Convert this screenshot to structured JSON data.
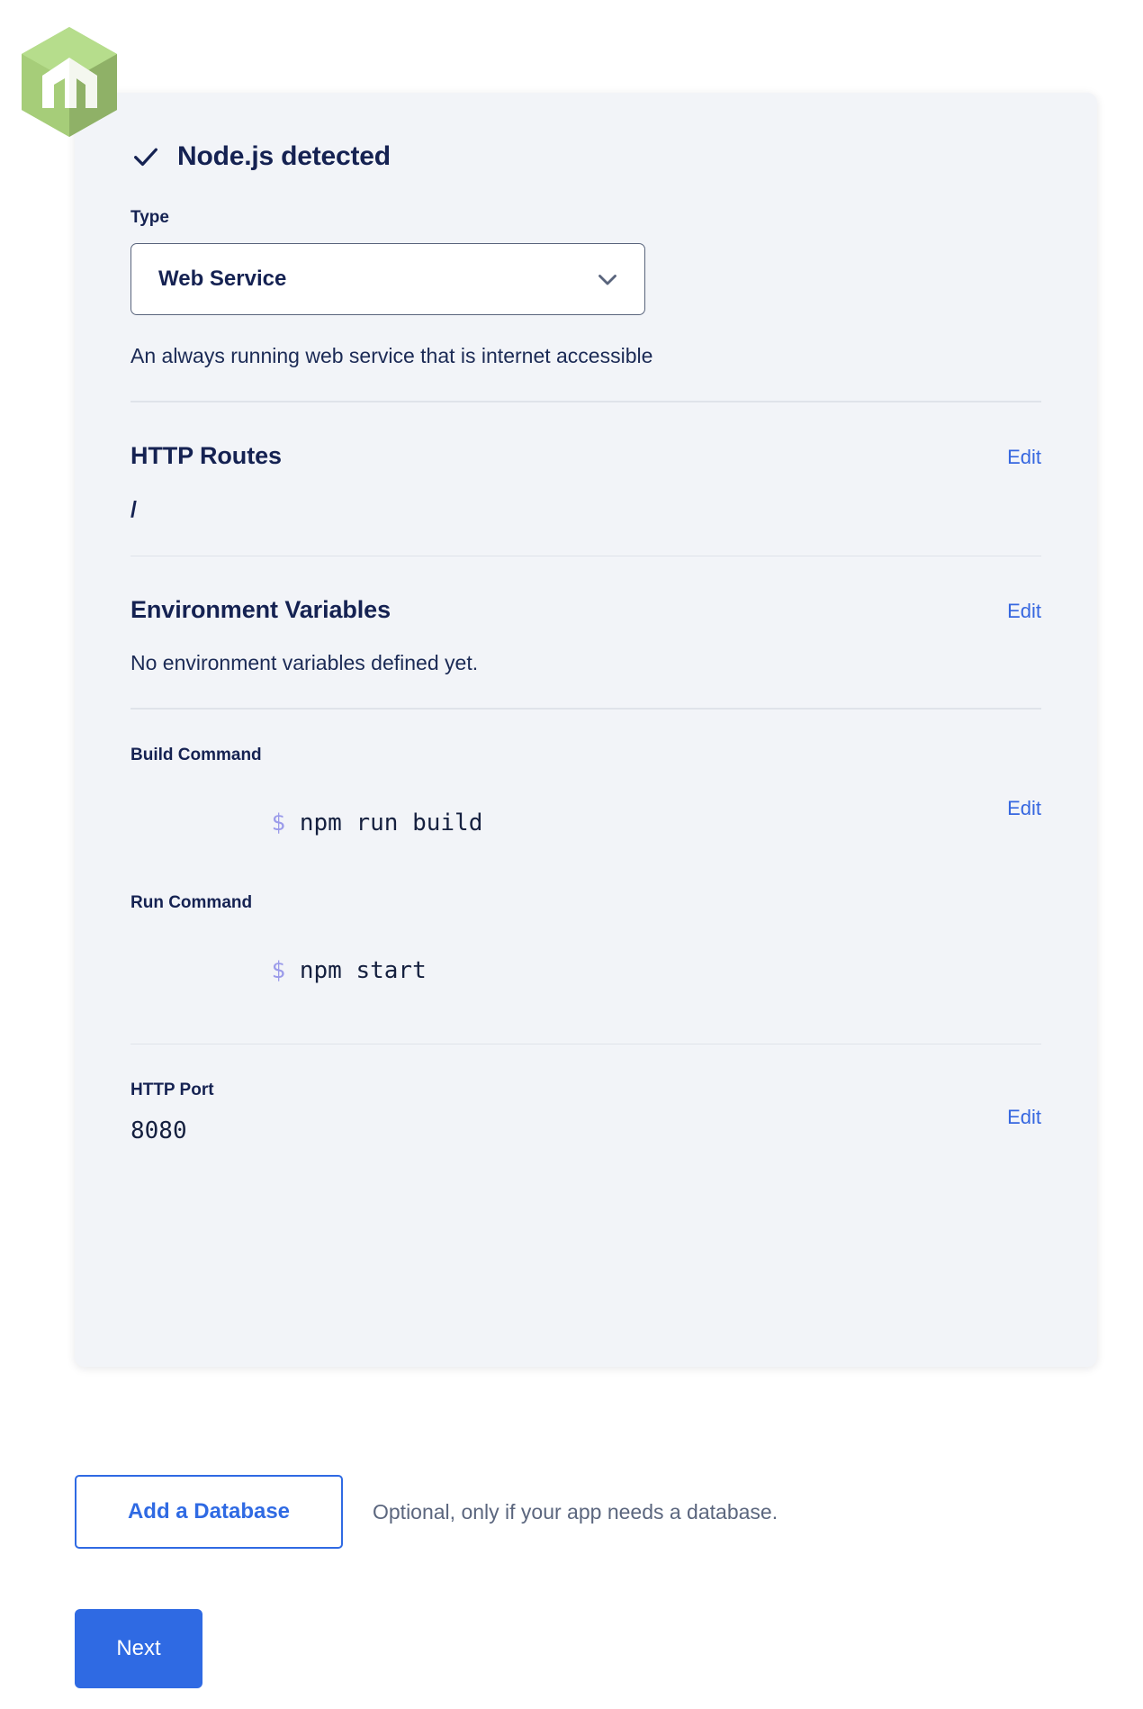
{
  "logo": {
    "icon": "nodejs-hexagon-logo",
    "colors": {
      "light": "#b2d98a",
      "mid": "#a2c96f",
      "dark": "#8aab5c",
      "side": "#7f9f55"
    }
  },
  "card": {
    "status": {
      "icon": "check-icon",
      "label": "Node.js detected"
    },
    "type": {
      "label": "Type",
      "value": "Web Service",
      "chevron_icon": "chevron-down-icon",
      "description": "An always running web service that is internet accessible"
    },
    "routes": {
      "title": "HTTP Routes",
      "edit_label": "Edit",
      "value": "/"
    },
    "env": {
      "title": "Environment Variables",
      "edit_label": "Edit",
      "empty_text": "No environment variables defined yet."
    },
    "build": {
      "label": "Build Command",
      "prompt": "$",
      "command": "npm run build",
      "edit_label": "Edit"
    },
    "run": {
      "label": "Run Command",
      "prompt": "$",
      "command": "npm start"
    },
    "port": {
      "label": "HTTP Port",
      "value": "8080",
      "edit_label": "Edit"
    }
  },
  "actions": {
    "add_database_label": "Add a Database",
    "database_note": "Optional, only if your app needs a database.",
    "next_label": "Next"
  },
  "colors": {
    "accent_blue": "#2f6ae3",
    "link_blue": "#3667e0",
    "card_bg": "#f2f4f8",
    "text_dark": "#152252",
    "prompt_purple": "#9b9bea",
    "muted": "#5b667e"
  }
}
